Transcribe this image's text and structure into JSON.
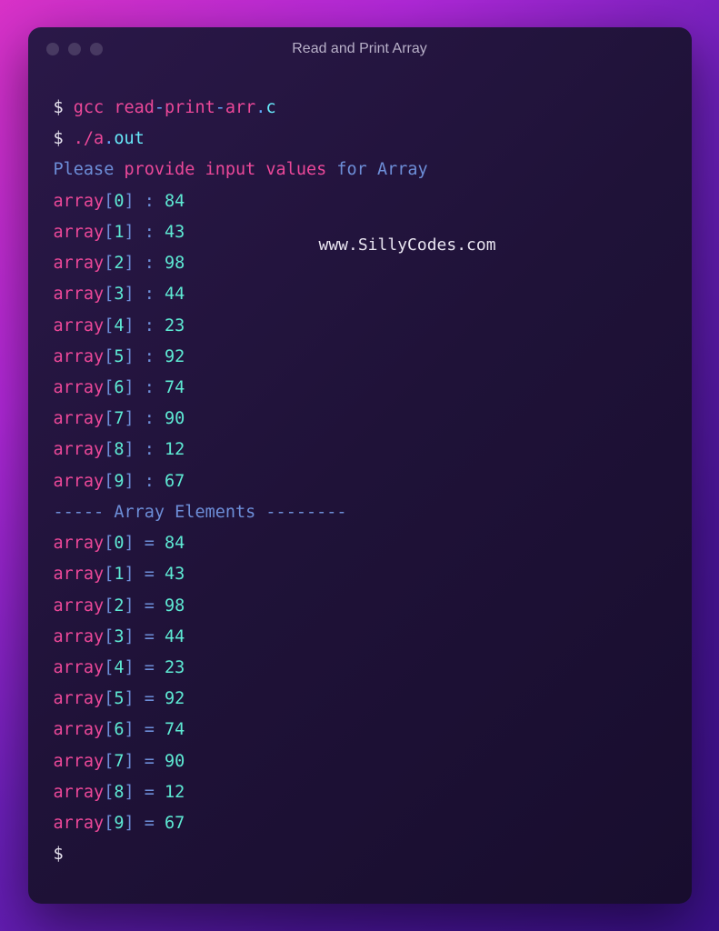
{
  "window": {
    "title": "Read and Print Array"
  },
  "watermark": "www.SillyCodes.com",
  "commands": {
    "line1_prompt": "$ ",
    "line1_cmd": "gcc read",
    "line1_dash": "-",
    "line1_rest": "print",
    "line1_dash2": "-",
    "line1_rest2": "arr",
    "line1_dot": ".",
    "line1_ext": "c",
    "line2_prompt": "$ ",
    "line2_cmd": "./a",
    "line2_dot": ".",
    "line2_out": "out"
  },
  "prompt_text": {
    "please": "Please",
    "provide": "provide",
    "input": "input",
    "values": "values",
    "for": "for",
    "array": "Array"
  },
  "inputs": [
    {
      "idx": "0",
      "val": "84"
    },
    {
      "idx": "1",
      "val": "43"
    },
    {
      "idx": "2",
      "val": "98"
    },
    {
      "idx": "3",
      "val": "44"
    },
    {
      "idx": "4",
      "val": "23"
    },
    {
      "idx": "5",
      "val": "92"
    },
    {
      "idx": "6",
      "val": "74"
    },
    {
      "idx": "7",
      "val": "90"
    },
    {
      "idx": "8",
      "val": "12"
    },
    {
      "idx": "9",
      "val": "67"
    }
  ],
  "separator": {
    "dashes1": "----- ",
    "text1": "Array",
    "text2": "Elements",
    "dashes2": " --------"
  },
  "outputs": [
    {
      "idx": "0",
      "val": "84"
    },
    {
      "idx": "1",
      "val": "43"
    },
    {
      "idx": "2",
      "val": "98"
    },
    {
      "idx": "3",
      "val": "44"
    },
    {
      "idx": "4",
      "val": "23"
    },
    {
      "idx": "5",
      "val": "92"
    },
    {
      "idx": "6",
      "val": "74"
    },
    {
      "idx": "7",
      "val": "90"
    },
    {
      "idx": "8",
      "val": "12"
    },
    {
      "idx": "9",
      "val": "67"
    }
  ],
  "labels": {
    "array_word": "array",
    "bracket_open": "[",
    "bracket_close": "]",
    "colon": " : ",
    "equals": " = "
  },
  "final_prompt": "$ "
}
